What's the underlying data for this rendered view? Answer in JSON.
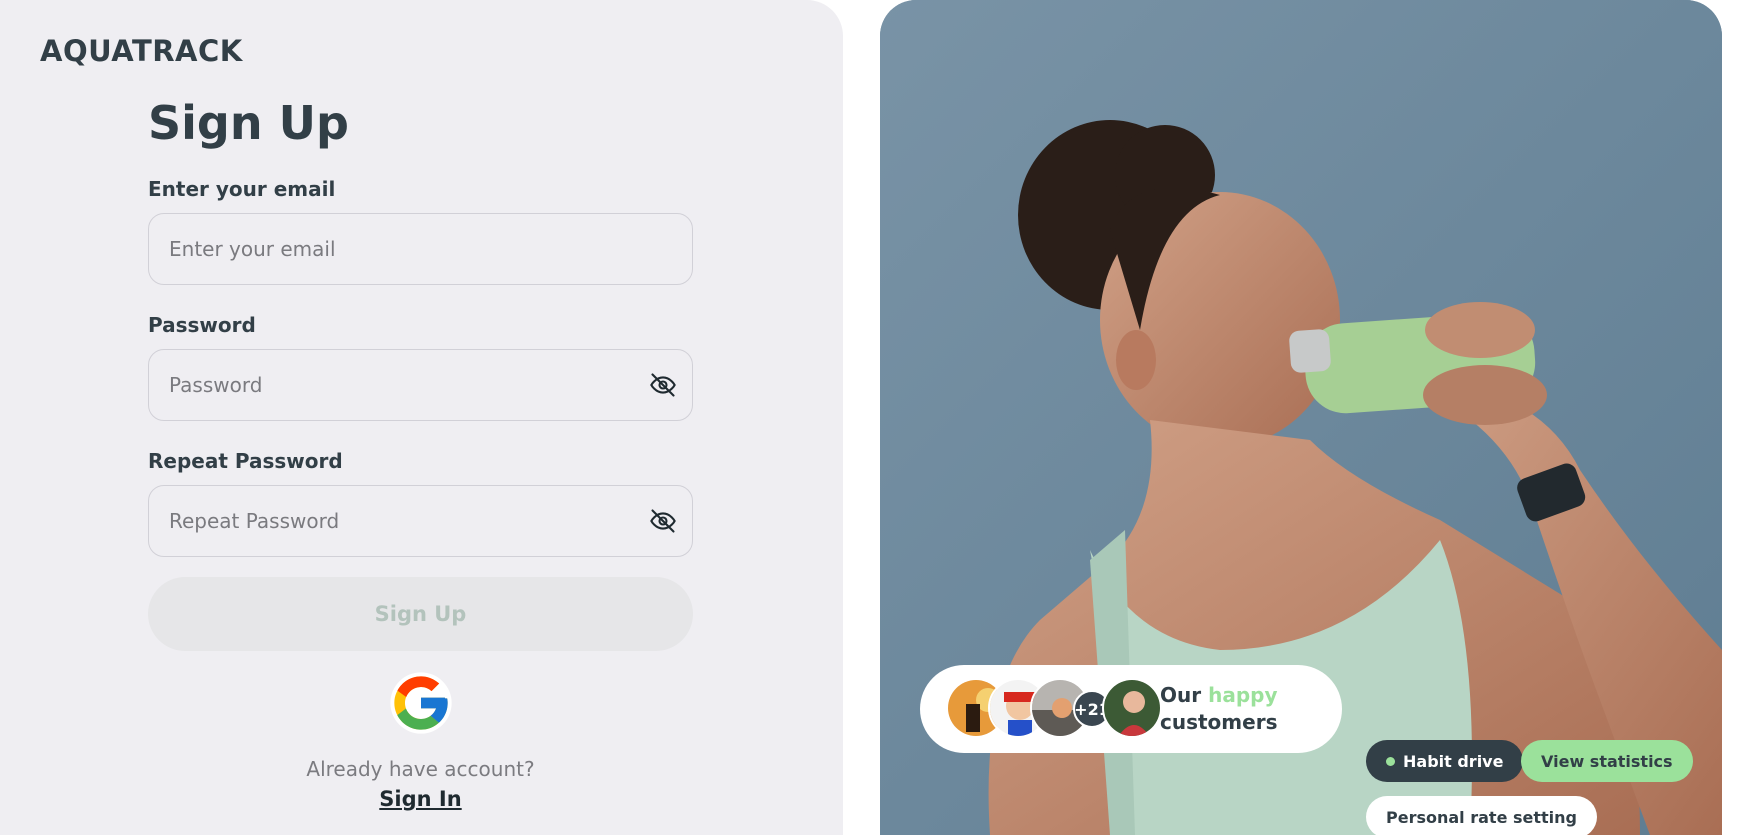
{
  "brand": {
    "logo": "AQUATRACK"
  },
  "signup": {
    "title": "Sign Up",
    "email_label": "Enter your email",
    "email_placeholder": "Enter your email",
    "password_label": "Password",
    "password_placeholder": "Password",
    "repeat_label": "Repeat Password",
    "repeat_placeholder": "Repeat Password",
    "submit_label": "Sign Up",
    "google_icon": "google-icon",
    "already_text": "Already have account?",
    "signin_link": "Sign In"
  },
  "hero": {
    "customers": {
      "plus_count": "+21",
      "text_prefix": "Our",
      "text_highlight": "happy",
      "text_suffix": "customers"
    },
    "badges": {
      "habit": "Habit drive",
      "stats": "View statistics",
      "rate": "Personal rate setting"
    }
  },
  "colors": {
    "accent_green": "#9be19b",
    "dark": "#323f47",
    "left_bg": "#efeef2"
  }
}
